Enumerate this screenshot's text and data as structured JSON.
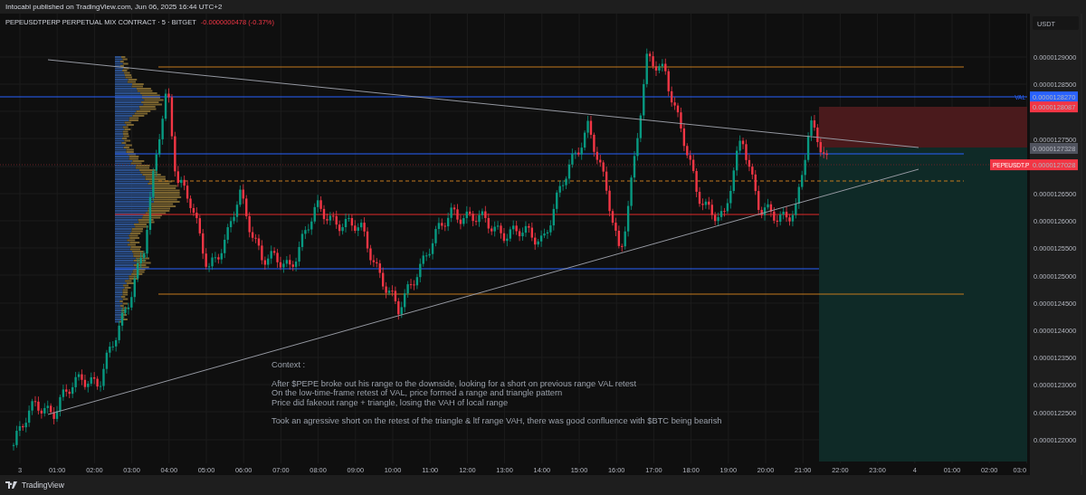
{
  "attribution": "Intocabl published on TradingView.com, Jun 06, 2025 16:44 UTC+2",
  "legend": {
    "symbol": "PEPEUSDTPERP PERPETUAL MIX CONTRACT · 5 · BITGET",
    "change": "-0.0000000478 (-0.37%)"
  },
  "price_axis": {
    "currency": "USDT",
    "ticks": [
      "0.0000129000",
      "0.0000128500",
      "0.0000127500",
      "0.0000126500",
      "0.0000126000",
      "0.0000125500",
      "0.0000125000",
      "0.0000124500",
      "0.0000124000",
      "0.0000123500",
      "0.0000123000",
      "0.0000122500",
      "0.0000122000"
    ],
    "markers": [
      {
        "value": "0.0000128270",
        "color": "#2962ff",
        "tag": "VAL",
        "kind": "plain"
      },
      {
        "value": "0.0000128087",
        "color": "#f23645"
      },
      {
        "value": "0.0000127328",
        "color": "#50535e"
      },
      {
        "value": "0.0000127028",
        "color": "#f23645",
        "tag": "PEPEUSDT.P",
        "kind": "boxed"
      }
    ]
  },
  "time_axis": [
    "3",
    "01:00",
    "02:00",
    "03:00",
    "04:00",
    "05:00",
    "06:00",
    "07:00",
    "08:00",
    "09:00",
    "10:00",
    "11:00",
    "12:00",
    "13:00",
    "14:00",
    "15:00",
    "16:00",
    "17:00",
    "18:00",
    "19:00",
    "20:00",
    "21:00",
    "22:00",
    "23:00",
    "4",
    "01:00",
    "02:00",
    "03:0"
  ],
  "annotation": {
    "title": "Context :",
    "paragraphs": [
      [
        "After $PEPE broke out his range to the downside, looking for a short on previous range VAL retest",
        "On the low-time-frame retest of VAL, price formed a range and triangle pattern",
        "Price did fakeout range + triangle, losing the VAH of local range"
      ],
      [
        "Took an agressive short on the retest of the triangle & ltf range VAH, there was good confluence with $BTC being bearish"
      ]
    ]
  },
  "footer": {
    "brand": "TradingView"
  }
}
